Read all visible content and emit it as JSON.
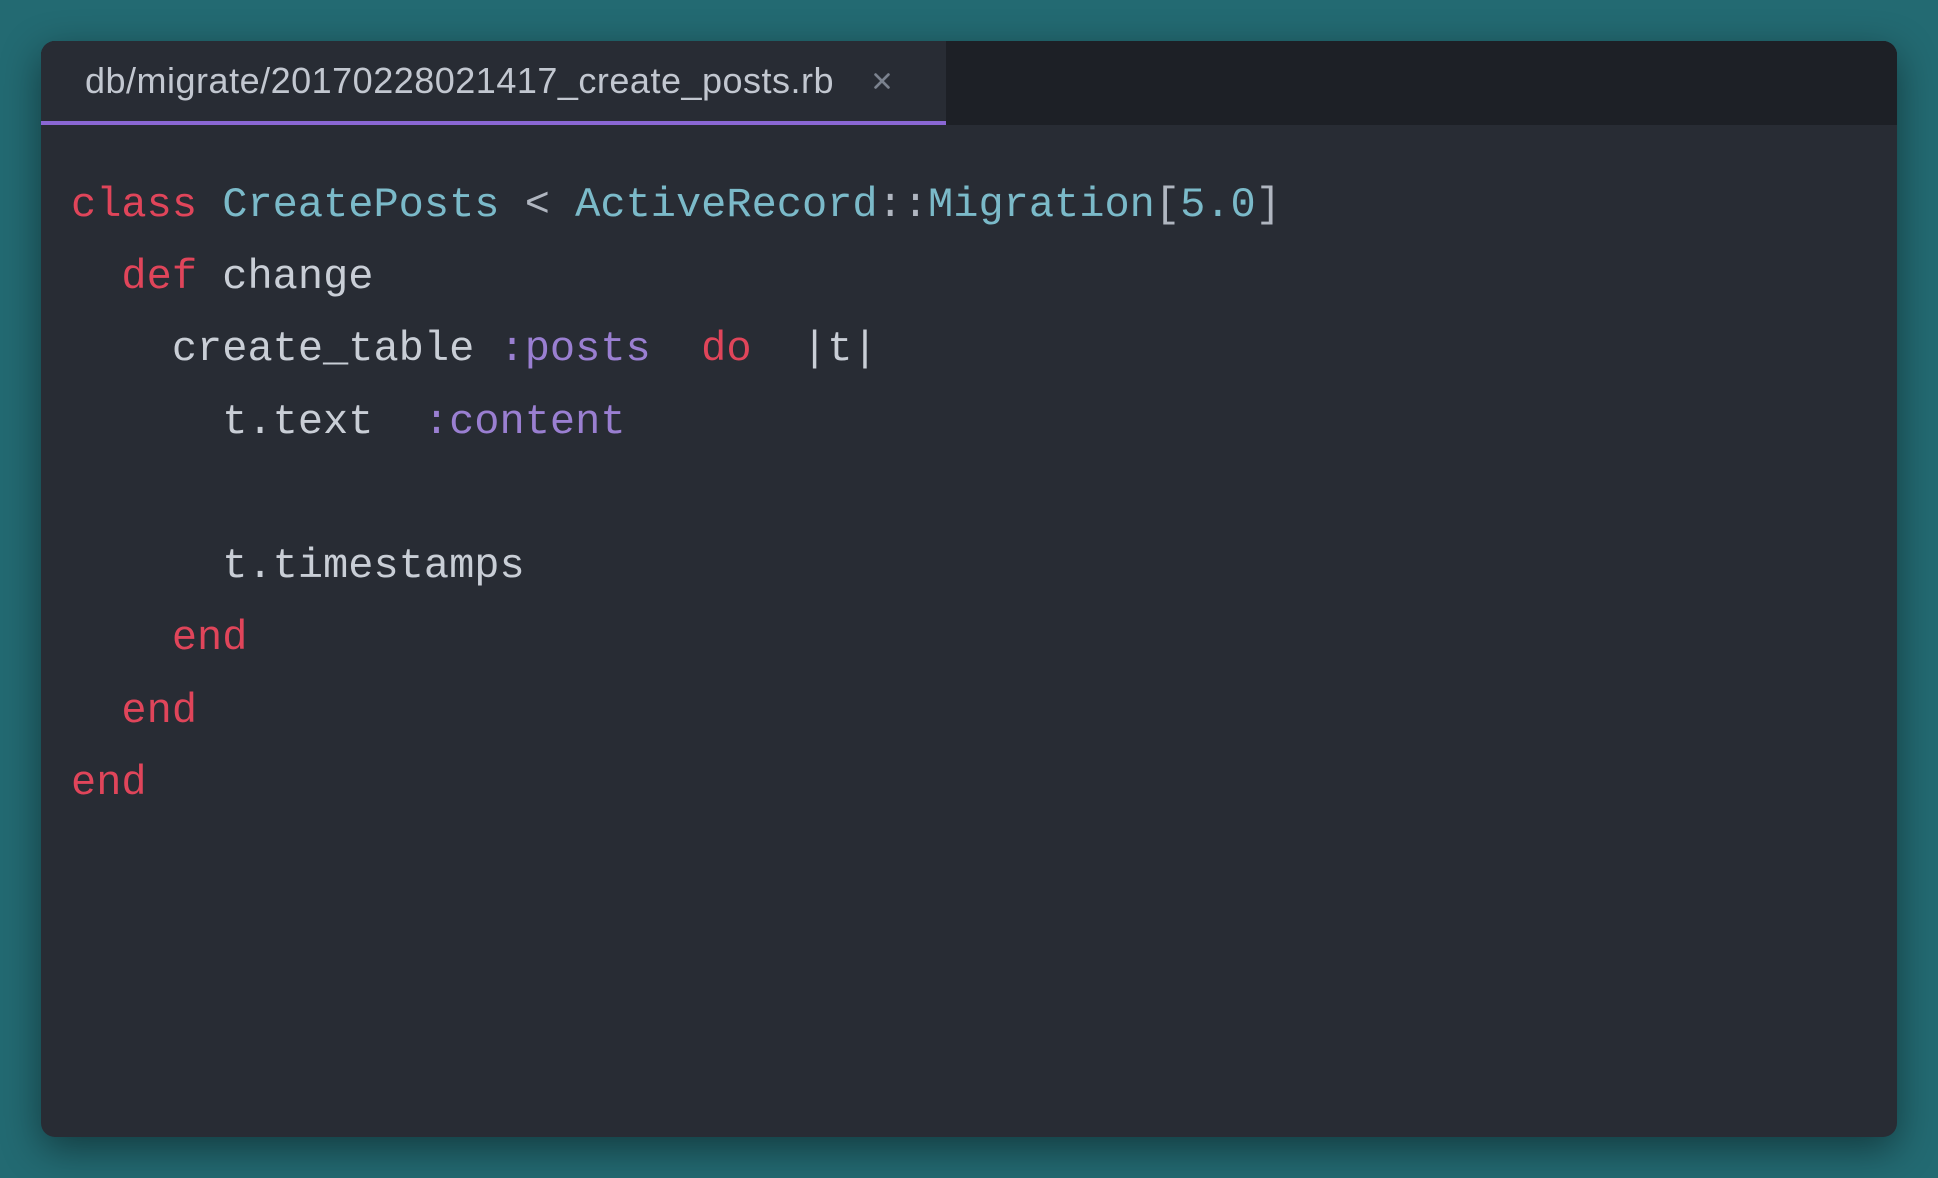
{
  "tab": {
    "filename": "db/migrate/20170228021417_create_posts.rb"
  },
  "code": {
    "kw_class": "class",
    "cls_createposts": "CreatePosts",
    "op_lt": "<",
    "cls_activerecord": "ActiveRecord",
    "op_coloncolon": "::",
    "cls_migration": "Migration",
    "op_lbracket": "[",
    "num_50": "5.0",
    "op_rbracket": "]",
    "kw_def": "def",
    "fn_change": "change",
    "fn_create_table": "create_table",
    "sym_posts": ":posts",
    "kw_do": "do",
    "pipe_t": "|t|",
    "expr_t_text": "t.text",
    "sym_content": ":content",
    "expr_t_timestamps": "t.timestamps",
    "kw_end1": "end",
    "kw_end2": "end",
    "kw_end3": "end",
    "indent1": "  ",
    "indent2": "    ",
    "indent3": "      ",
    "sp": " ",
    "sp2": "  "
  }
}
